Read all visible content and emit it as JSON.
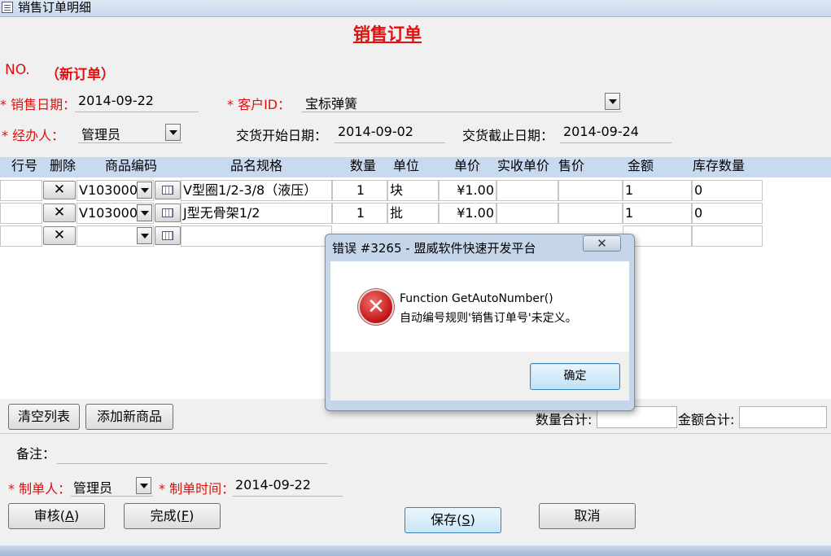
{
  "window": {
    "title": "销售订单明细"
  },
  "form": {
    "heading": "销售订单",
    "no_label": "NO.",
    "no_value": "（新订单）",
    "sale_date_label": "* 销售日期：",
    "sale_date_value": "2014-09-22",
    "customer_label": "* 客户ID：",
    "customer_value": "宝标弹簧",
    "handler_label": "* 经办人：",
    "handler_value": "管理员",
    "delivery_start_label": "交货开始日期：",
    "delivery_start_value": "2014-09-02",
    "delivery_end_label": "交货截止日期：",
    "delivery_end_value": "2014-09-24"
  },
  "grid": {
    "headers": {
      "row_no": "行号",
      "delete": "删除",
      "product_code": "商品编码",
      "name_spec": "品名规格",
      "quantity": "数量",
      "unit": "单位",
      "unit_price": "单价",
      "actual_price": "实收单价",
      "sale_price": "售价",
      "amount": "金额",
      "stock": "库存数量"
    },
    "delete_glyph": "✕",
    "rows": [
      {
        "code": "V103000",
        "name": "V型圈1/2-3/8（液压）",
        "qty": "1",
        "unit": "块",
        "price": "¥1.00",
        "amount": "1",
        "stock": "0"
      },
      {
        "code": "V103000",
        "name": "J型无骨架1/2",
        "qty": "1",
        "unit": "批",
        "price": "¥1.00",
        "amount": "1",
        "stock": "0"
      }
    ]
  },
  "buttons": {
    "clear_list": "清空列表",
    "add_product": "添加新商品",
    "review": "审核(A)",
    "complete": "完成(F)",
    "save": "保存(S)",
    "cancel": "取消"
  },
  "totals": {
    "qty_total_label": "数量合计:",
    "amount_total_label": "金额合计:"
  },
  "footer": {
    "remarks_label": "备注：",
    "maker_label": "* 制单人：",
    "maker_value": "管理员",
    "make_time_label": "* 制单时间：",
    "make_time_value": "2014-09-22"
  },
  "dialog": {
    "title": "错误 #3265 - 盟威软件快速开发平台",
    "close_glyph": "✕",
    "icon": "error-icon",
    "message_line1": "Function GetAutoNumber()",
    "message_line2": "自动编号规则'销售订单号'未定义。",
    "ok_label": "确定"
  }
}
